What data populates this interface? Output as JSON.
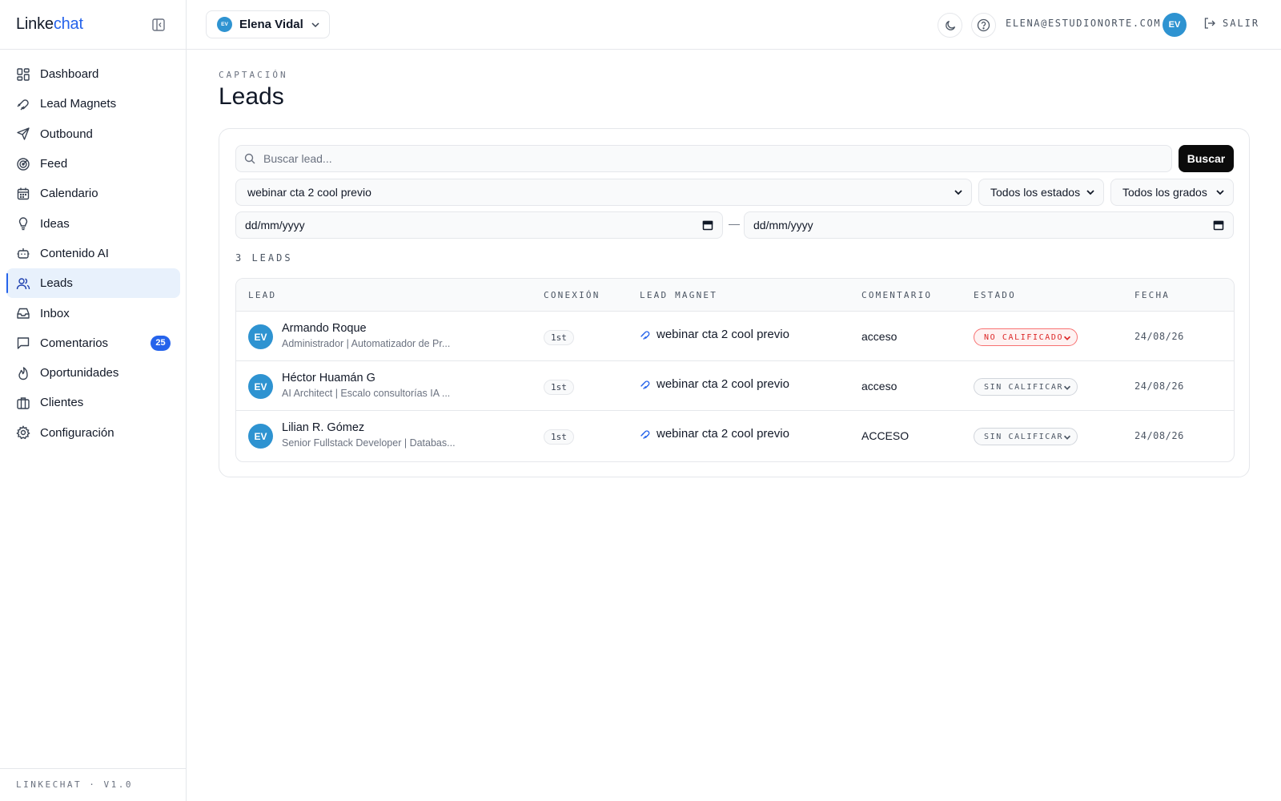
{
  "brand": {
    "part1": "Linke",
    "part2": "chat"
  },
  "sidebar": {
    "items": [
      {
        "label": "Dashboard",
        "icon": "dashboard-icon"
      },
      {
        "label": "Lead Magnets",
        "icon": "magnet-icon"
      },
      {
        "label": "Outbound",
        "icon": "send-icon"
      },
      {
        "label": "Feed",
        "icon": "radar-icon"
      },
      {
        "label": "Calendario",
        "icon": "calendar-icon"
      },
      {
        "label": "Ideas",
        "icon": "lightbulb-icon"
      },
      {
        "label": "Contenido AI",
        "icon": "bot-icon"
      },
      {
        "label": "Leads",
        "icon": "users-icon",
        "active": true
      },
      {
        "label": "Inbox",
        "icon": "inbox-icon"
      },
      {
        "label": "Comentarios",
        "icon": "message-icon",
        "badge": "25"
      },
      {
        "label": "Oportunidades",
        "icon": "flame-icon"
      },
      {
        "label": "Clientes",
        "icon": "briefcase-icon"
      },
      {
        "label": "Configuración",
        "icon": "settings-icon"
      }
    ],
    "footer": "LINKECHAT · V1.0"
  },
  "topbar": {
    "account": {
      "initials": "EV",
      "name": "Elena Vidal"
    },
    "email": "ELENA@ESTUDIONORTE.COM",
    "avatar": "EV",
    "logout": "SALIR"
  },
  "page": {
    "eyebrow": "CAPTACIÓN",
    "title": "Leads"
  },
  "filters": {
    "search_placeholder": "Buscar lead...",
    "search_button": "Buscar",
    "lead_magnet": "webinar cta 2 cool previo",
    "estado": "Todos los estados",
    "grado": "Todos los grados",
    "date_from": "dd/mm/yyyy",
    "date_to": "dd/mm/yyyy",
    "date_separator": "—"
  },
  "count": "3 LEADS",
  "table": {
    "headers": [
      "LEAD",
      "CONEXIÓN",
      "LEAD MAGNET",
      "COMENTARIO",
      "ESTADO",
      "FECHA"
    ],
    "rows": [
      {
        "initials": "EV",
        "name": "Armando Roque",
        "subtitle": "Administrador | Automatizador de Pr...",
        "conexion": "1st",
        "lead_magnet": "webinar cta 2 cool previo",
        "comentario": "acceso",
        "estado": "NO CALIFICADO",
        "fecha": "24/08/26"
      },
      {
        "initials": "EV",
        "name": "Héctor Huamán G",
        "subtitle": "AI Architect | Escalo consultorías IA ...",
        "conexion": "1st",
        "lead_magnet": "webinar cta 2 cool previo",
        "comentario": "acceso",
        "estado": "SIN CALIFICAR",
        "fecha": "24/08/26"
      },
      {
        "initials": "EV",
        "name": "Lilian R. Gómez",
        "subtitle": "Senior Fullstack Developer | Databas...",
        "conexion": "1st",
        "lead_magnet": "webinar cta 2 cool previo",
        "comentario": "ACCESO",
        "estado": "SIN CALIFICAR",
        "fecha": "24/08/26"
      }
    ]
  },
  "colors": {
    "accent": "#2563eb",
    "active_bg": "#e8f1fc",
    "avatar": "#2e93d1",
    "danger": "#dc2626"
  }
}
